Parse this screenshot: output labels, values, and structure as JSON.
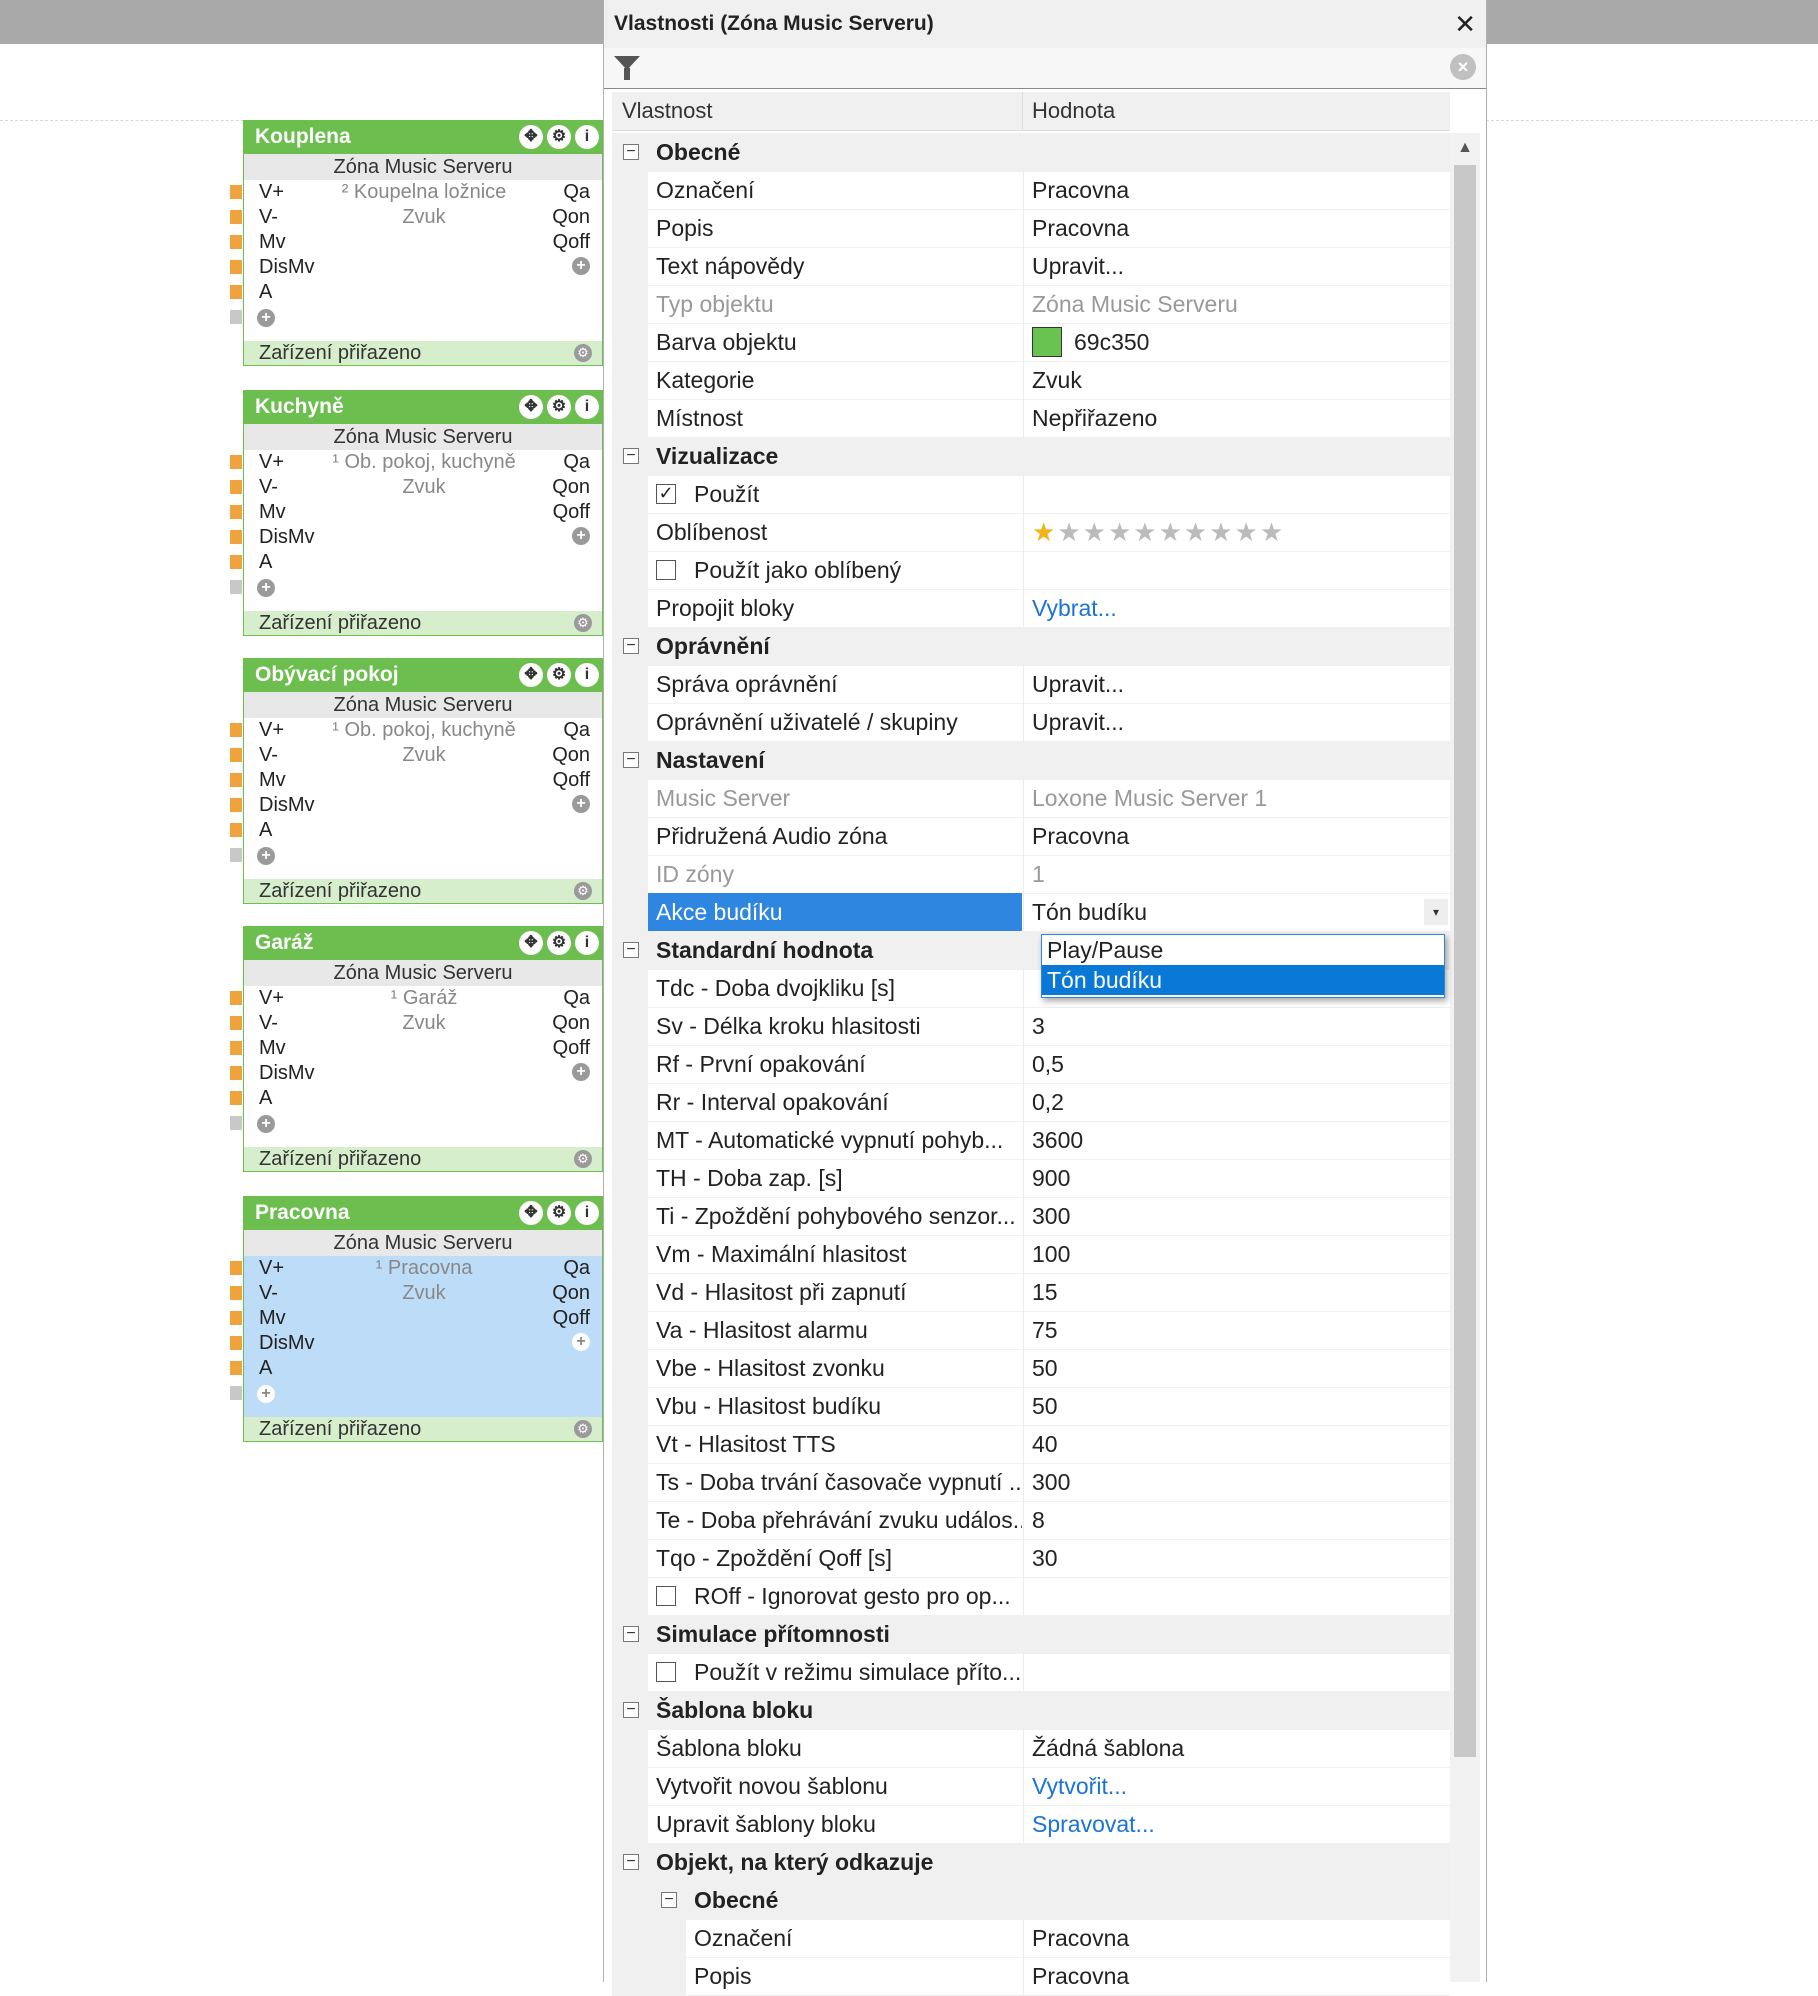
{
  "blocks": [
    {
      "title": "Kouplena",
      "subtitle": "Zóna Music Serveru",
      "room": "² Koupelna ložnice",
      "category": "Zvuk",
      "inputs": [
        "V+",
        "V-",
        "Mv",
        "DisMv",
        "A"
      ],
      "outputs": [
        "Qa",
        "Qon",
        "Qoff"
      ],
      "footer": "Zařízení přiřazeno",
      "selected": false
    },
    {
      "title": "Kuchyně",
      "subtitle": "Zóna Music Serveru",
      "room": "¹ Ob. pokoj, kuchyně",
      "category": "Zvuk",
      "inputs": [
        "V+",
        "V-",
        "Mv",
        "DisMv",
        "A"
      ],
      "outputs": [
        "Qa",
        "Qon",
        "Qoff"
      ],
      "footer": "Zařízení přiřazeno",
      "selected": false
    },
    {
      "title": "Obývací pokoj",
      "subtitle": "Zóna Music Serveru",
      "room": "¹ Ob. pokoj, kuchyně",
      "category": "Zvuk",
      "inputs": [
        "V+",
        "V-",
        "Mv",
        "DisMv",
        "A"
      ],
      "outputs": [
        "Qa",
        "Qon",
        "Qoff"
      ],
      "footer": "Zařízení přiřazeno",
      "selected": false
    },
    {
      "title": "Garáž",
      "subtitle": "Zóna Music Serveru",
      "room": "¹ Garáž",
      "category": "Zvuk",
      "inputs": [
        "V+",
        "V-",
        "Mv",
        "DisMv",
        "A"
      ],
      "outputs": [
        "Qa",
        "Qon",
        "Qoff"
      ],
      "footer": "Zařízení přiřazeno",
      "selected": false
    },
    {
      "title": "Pracovna",
      "subtitle": "Zóna Music Serveru",
      "room": "¹ Pracovna",
      "category": "Zvuk",
      "inputs": [
        "V+",
        "V-",
        "Mv",
        "DisMv",
        "A"
      ],
      "outputs": [
        "Qa",
        "Qon",
        "Qoff"
      ],
      "footer": "Zařízení přiřazeno",
      "selected": true
    }
  ],
  "panel": {
    "title": "Vlastnosti (Zóna Music Serveru)",
    "close_glyph": "✕",
    "columns": {
      "property": "Vlastnost",
      "value": "Hodnota"
    },
    "rows": [
      {
        "type": "category",
        "name": "Obecné"
      },
      {
        "name": "Označení",
        "value": "Pracovna"
      },
      {
        "name": "Popis",
        "value": "Pracovna"
      },
      {
        "name": "Text nápovědy",
        "value": "Upravit..."
      },
      {
        "name": "Typ objektu",
        "value": "Zóna Music Serveru",
        "disabled": true
      },
      {
        "name": "Barva objektu",
        "value": "69c350",
        "swatch": "#69c350"
      },
      {
        "name": "Kategorie",
        "value": "Zvuk"
      },
      {
        "name": "Místnost",
        "value": "Nepřiřazeno"
      },
      {
        "type": "category",
        "name": "Vizualizace"
      },
      {
        "name": "Použít",
        "checkbox": true,
        "checked": true,
        "value": ""
      },
      {
        "name": "Oblíbenost",
        "stars": {
          "on": 1,
          "total": 10
        },
        "value": ""
      },
      {
        "name": "Použít jako oblíbený",
        "checkbox": true,
        "checked": false,
        "value": ""
      },
      {
        "name": "Propojit bloky",
        "value": "Vybrat...",
        "link": true
      },
      {
        "type": "category",
        "name": "Oprávnění"
      },
      {
        "name": "Správa oprávnění",
        "value": "Upravit..."
      },
      {
        "name": "Oprávnění uživatelé / skupiny",
        "value": "Upravit..."
      },
      {
        "type": "category",
        "name": "Nastavení"
      },
      {
        "name": "Music Server",
        "value": "Loxone Music Server 1",
        "disabled": true
      },
      {
        "name": "Přidružená Audio zóna",
        "value": "Pracovna"
      },
      {
        "name": "ID zóny",
        "value": "1",
        "disabled": true
      },
      {
        "name": "Akce budíku",
        "value": "Tón budíku",
        "selected": true,
        "dropdown": true
      },
      {
        "type": "category",
        "name": "Standardní hodnota"
      },
      {
        "name": "Tdc - Doba dvojkliku [s]",
        "value": ""
      },
      {
        "name": "Sv - Délka kroku hlasitosti",
        "value": "3"
      },
      {
        "name": "Rf - První opakování",
        "value": "0,5"
      },
      {
        "name": "Rr - Interval opakování",
        "value": "0,2"
      },
      {
        "name": "MT - Automatické vypnutí pohyb...",
        "value": "3600"
      },
      {
        "name": "TH - Doba zap. [s]",
        "value": "900"
      },
      {
        "name": "Ti - Zpoždění pohybového senzor...",
        "value": "300"
      },
      {
        "name": "Vm - Maximální hlasitost",
        "value": "100"
      },
      {
        "name": "Vd - Hlasitost při zapnutí",
        "value": "15"
      },
      {
        "name": "Va - Hlasitost alarmu",
        "value": "75"
      },
      {
        "name": "Vbe - Hlasitost zvonku",
        "value": "50"
      },
      {
        "name": "Vbu - Hlasitost budíku",
        "value": "50"
      },
      {
        "name": "Vt - Hlasitost TTS",
        "value": "40"
      },
      {
        "name": "Ts - Doba trvání časovače vypnutí ...",
        "value": "300"
      },
      {
        "name": "Te - Doba přehrávání zvuku událos...",
        "value": "8"
      },
      {
        "name": "Tqo - Zpoždění Qoff [s]",
        "value": "30"
      },
      {
        "name": "ROff - Ignorovat gesto pro op...",
        "checkbox": true,
        "checked": false,
        "value": ""
      },
      {
        "type": "category",
        "name": "Simulace přítomnosti"
      },
      {
        "name": "Použít v režimu simulace příto...",
        "checkbox": true,
        "checked": false,
        "value": ""
      },
      {
        "type": "category",
        "name": "Šablona bloku"
      },
      {
        "name": "Šablona bloku",
        "value": "Žádná šablona"
      },
      {
        "name": "Vytvořit novou šablonu",
        "value": "Vytvořit...",
        "link": true
      },
      {
        "name": "Upravit šablony bloku",
        "value": "Spravovat...",
        "link": true
      },
      {
        "type": "category",
        "name": "Objekt, na který odkazuje"
      },
      {
        "type": "category",
        "name": "Obecné",
        "sub": true
      },
      {
        "name": "Označení",
        "value": "Pracovna",
        "sub": true
      },
      {
        "name": "Popis",
        "value": "Pracovna",
        "sub": true
      }
    ],
    "dropdown_options": [
      {
        "label": "Play/Pause",
        "selected": false
      },
      {
        "label": "Tón budíku",
        "selected": true
      }
    ]
  }
}
